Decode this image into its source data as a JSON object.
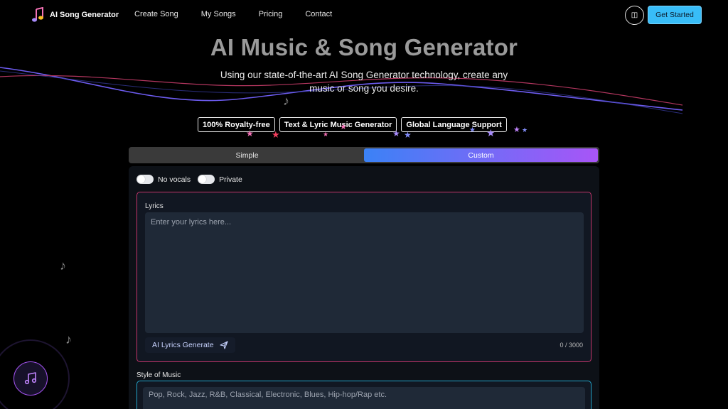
{
  "nav": {
    "brand": "AI Song Generator",
    "links": [
      "Create Song",
      "My Songs",
      "Pricing",
      "Contact"
    ],
    "theme_toggle": "◫",
    "cta": "Get Started"
  },
  "hero": {
    "title": "AI Music & Song Generator",
    "subtitle": "Using our state-of-the-art AI Song Generator technology, create any music or song you desire."
  },
  "badges": [
    "100% Royalty-free",
    "Text & Lyric Music Generator",
    "Global Language Support"
  ],
  "tabs": [
    {
      "label": "Simple",
      "active": false
    },
    {
      "label": "Custom",
      "active": true
    }
  ],
  "toggles": {
    "no_vocals": "No vocals",
    "private": "Private"
  },
  "lyrics": {
    "label": "Lyrics",
    "placeholder": "Enter your lyrics here...",
    "ai_button": "AI Lyrics Generate",
    "counter": "0 / 3000"
  },
  "style": {
    "label": "Style of Music",
    "placeholder": "Pop, Rock, Jazz, R&B, Classical, Electronic, Blues, Hip-hop/Rap etc."
  },
  "colors": {
    "accent": "#38bdf8",
    "tab_gradient_start": "#3b82f6",
    "tab_gradient_end": "#a855f7",
    "lyrics_border": "#c2356b",
    "style_border": "#22a3c9"
  },
  "icons": {
    "brand": "music-note-icon",
    "send": "send-icon",
    "player": "music-note-icon"
  }
}
